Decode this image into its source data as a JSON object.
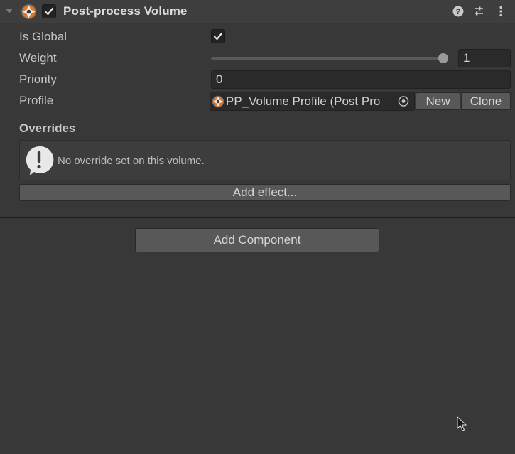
{
  "colors": {
    "panel_bg": "#383838",
    "header_bg": "#3e3e3e",
    "field_bg": "#2a2a2a",
    "button_bg": "#585858",
    "text": "#c4c4c4",
    "icon_orange": "#e0772a"
  },
  "component": {
    "title": "Post-process Volume",
    "enabled": true,
    "header_icons": [
      "help-icon",
      "preset-sliders-icon",
      "more-options-icon"
    ]
  },
  "fields": {
    "is_global": {
      "label": "Is Global",
      "checked": true
    },
    "weight": {
      "label": "Weight",
      "value": "1",
      "slider_fraction": 1.0
    },
    "priority": {
      "label": "Priority",
      "value": "0"
    },
    "profile": {
      "label": "Profile",
      "value": "PP_Volume Profile (Post Pro",
      "new_label": "New",
      "clone_label": "Clone"
    }
  },
  "overrides": {
    "label": "Overrides",
    "help_text": "No override set on this volume.",
    "add_effect_label": "Add effect..."
  },
  "add_component_label": "Add Component"
}
